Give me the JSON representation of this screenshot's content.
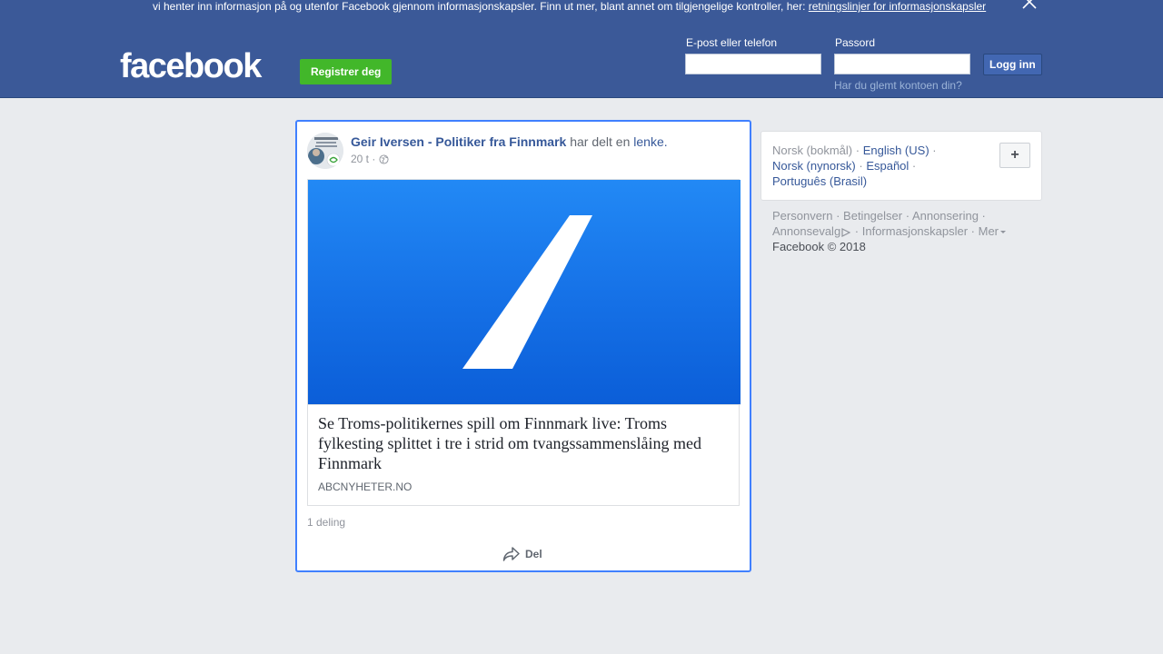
{
  "cookie_bar": {
    "text": "vi henter inn informasjon på og utenfor Facebook gjennom informasjonskapsler. Finn ut mer, blant annet om tilgjengelige kontroller, her:",
    "link": "retningslinjer for informasjonskapsler",
    "close_icon": "close-icon"
  },
  "header": {
    "logo": "facebook",
    "register_label": "Registrer deg",
    "email_label": "E-post eller telefon",
    "password_label": "Passord",
    "login_label": "Logg inn",
    "forgot_label": "Har du glemt kontoen din?",
    "email_value": "",
    "password_value": ""
  },
  "post": {
    "author": "Geir Iversen - Politiker fra Finnmark",
    "action_text": "har delt en",
    "link_word": "lenke.",
    "time": "20 t ·",
    "privacy_icon": "globe-icon",
    "link": {
      "title": "Se Troms-politikernes spill om Finnmark live: Troms fylkesting splittet i tre i strid om tvangssammenslåing med Finnmark",
      "domain": "ABCNYHETER.NO"
    },
    "share_count": "1 deling",
    "share_label": "Del"
  },
  "languages": {
    "current": "Norsk (bokmål)",
    "links": [
      "English (US)",
      "Norsk (nynorsk)",
      "Español",
      "Português (Brasil)"
    ],
    "sep": " · ",
    "add_label": "+"
  },
  "footer": {
    "links": [
      "Personvern",
      "Betingelser",
      "Annonsering",
      "Annonsevalg",
      "Informasjonskapsler",
      "Mer"
    ],
    "sep": " · ",
    "copyright": "Facebook © 2018"
  },
  "colors": {
    "brand": "#3b5998",
    "register": "#42b72a",
    "highlight_border": "#4080ff",
    "link": "#365899"
  }
}
